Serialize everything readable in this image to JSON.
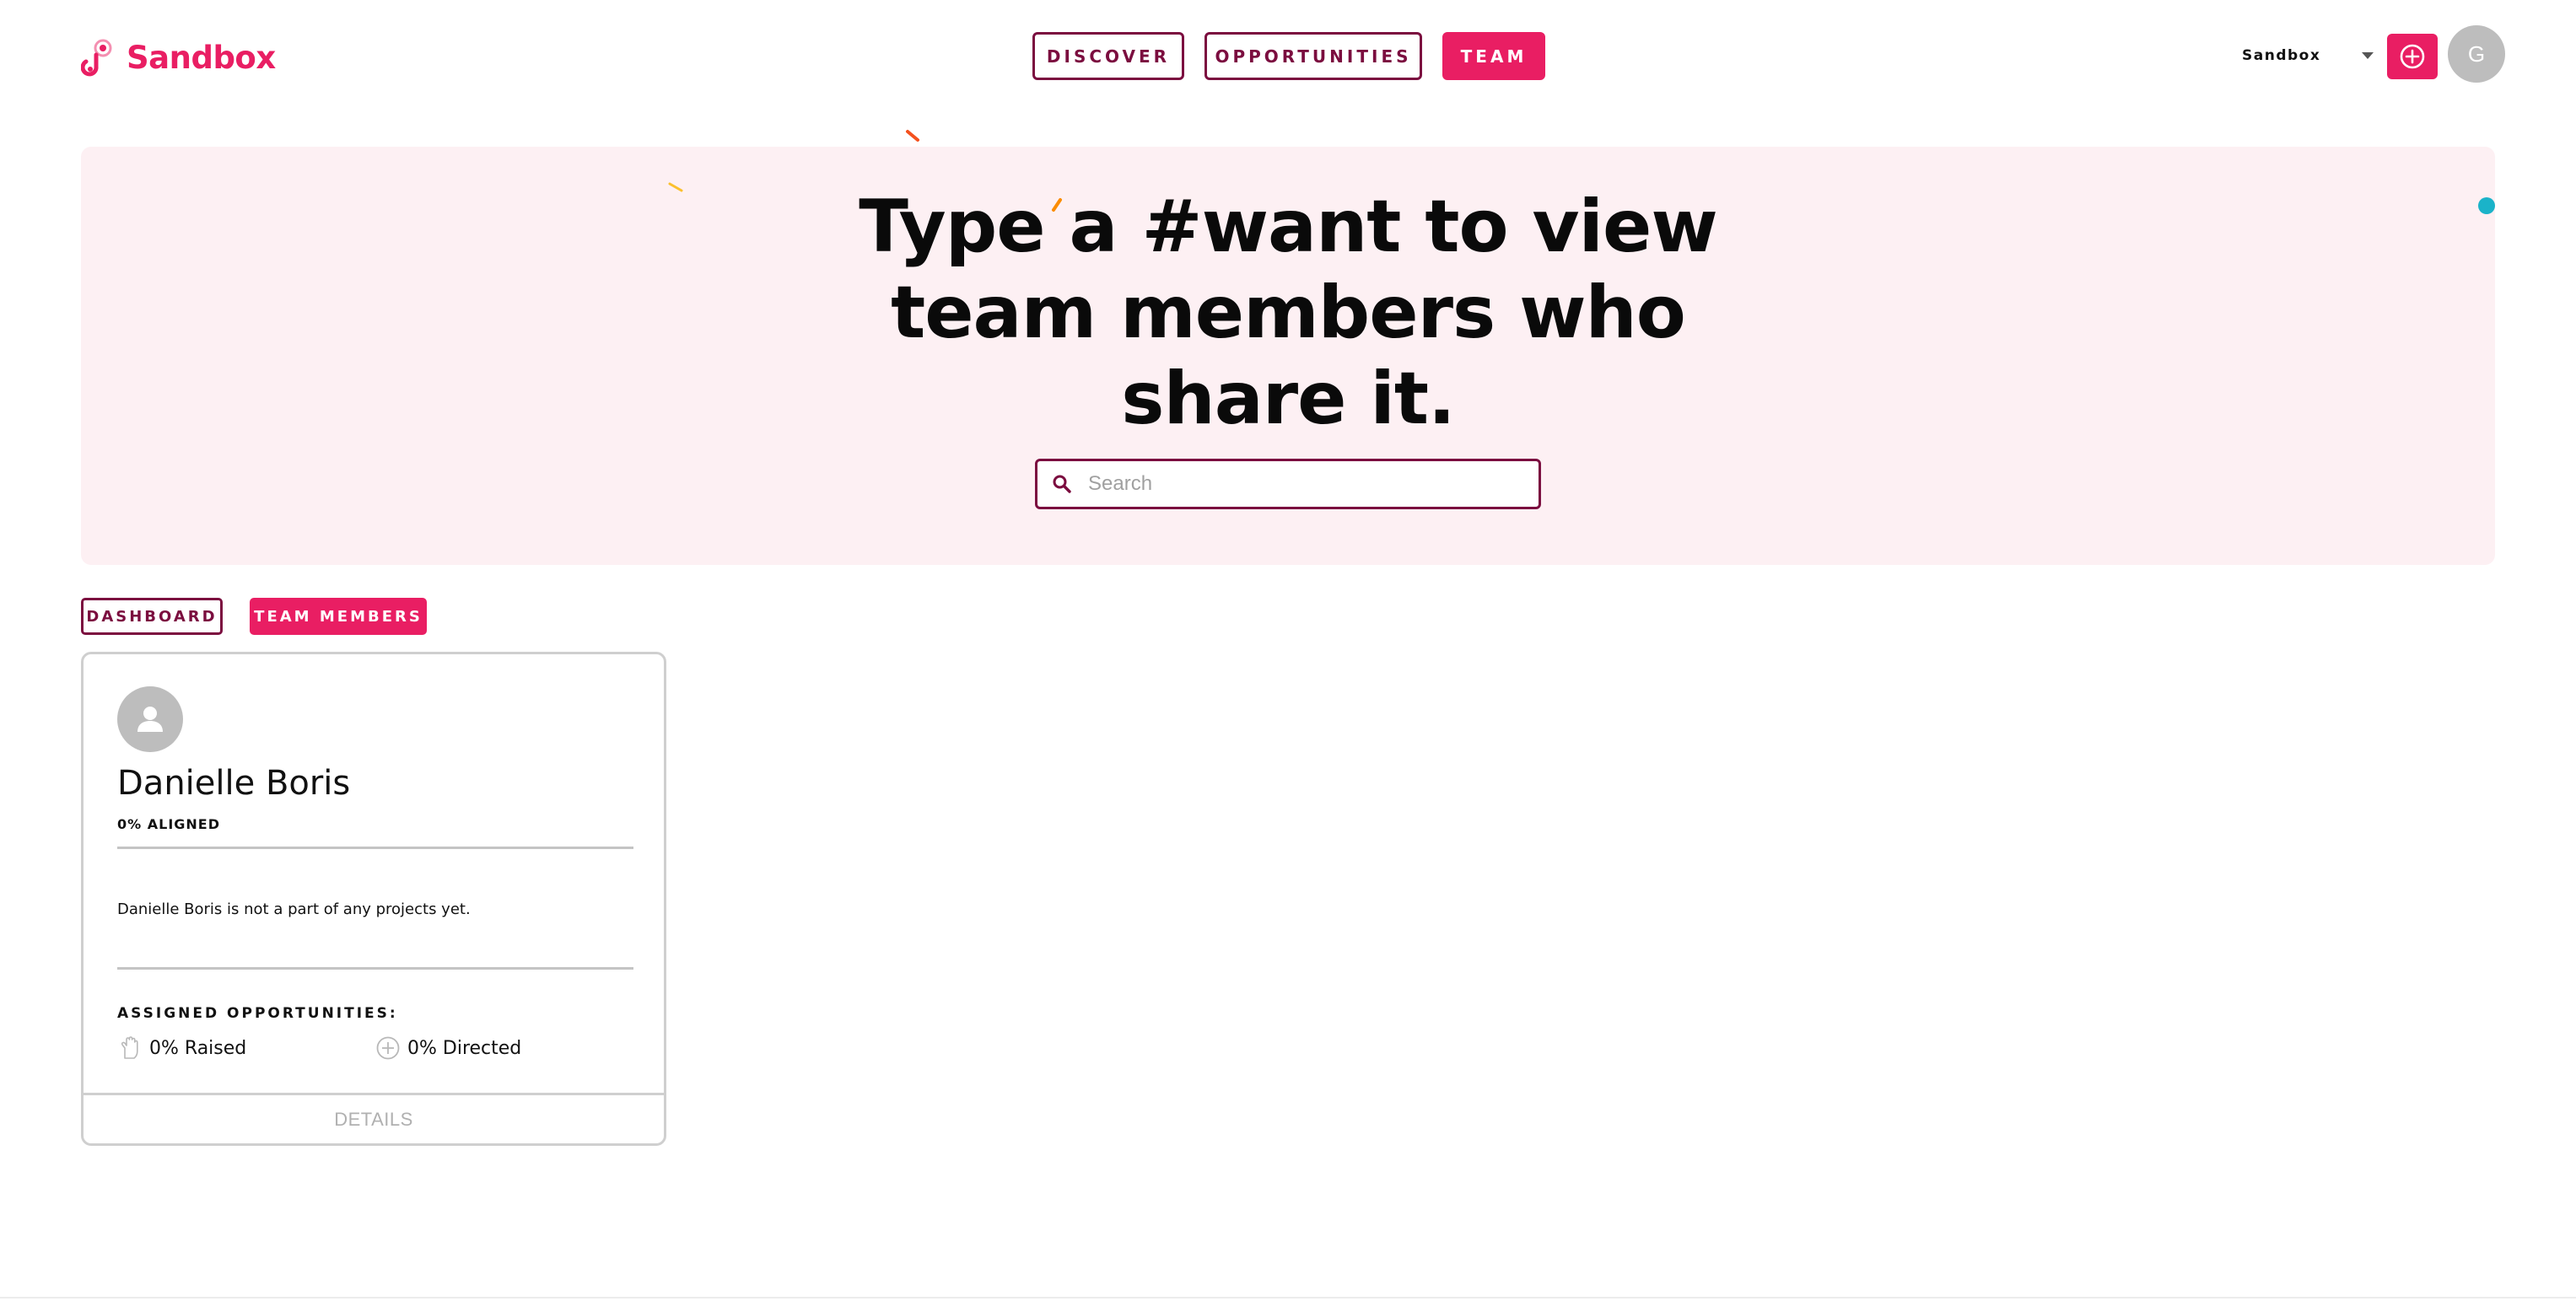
{
  "brand": {
    "name": "Sandbox",
    "color": "#e91e63",
    "accent_dark": "#7b0d3f"
  },
  "nav": {
    "discover_label": "DISCOVER",
    "opportunities_label": "OPPORTUNITIES",
    "team_label": "TEAM",
    "active": "TEAM"
  },
  "account": {
    "org_name": "Sandbox",
    "add_icon": "plus-circle-icon",
    "avatar_initial": "G"
  },
  "hero": {
    "title_lines": [
      "Type a #want to view",
      "team members who",
      "share it."
    ],
    "search_placeholder": "Search",
    "search_value": "",
    "background": "#fdf0f3"
  },
  "subtabs": {
    "dashboard_label": "DASHBOARD",
    "team_members_label": "TEAM MEMBERS",
    "active": "TEAM MEMBERS"
  },
  "members": [
    {
      "name": "Danielle Boris",
      "aligned": "0% ALIGNED",
      "projects_text": "Danielle Boris is not a part of any projects yet.",
      "assigned_label": "ASSIGNED OPPORTUNITIES:",
      "raised": "0% Raised",
      "directed": "0% Directed",
      "details_label": "DETAILS"
    }
  ]
}
